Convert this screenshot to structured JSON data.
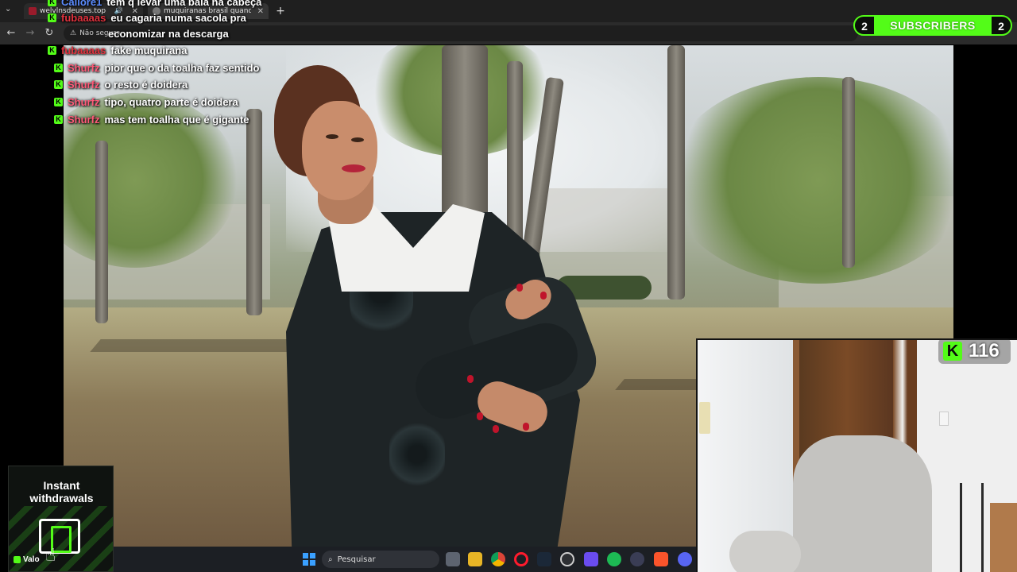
{
  "browser": {
    "tabs": [
      {
        "label": "welvlnsdeuses.top"
      },
      {
        "label": "muquiranas brasil quando foi gr"
      }
    ],
    "new_tab": "+",
    "security": "Não segura"
  },
  "chat": {
    "messages": [
      {
        "user": "Callore1",
        "user_color": "#5b8cff",
        "text": "tem q levar uma bala na cabeça"
      },
      {
        "user": "fubaaaas",
        "user_color": "#e2323e",
        "text": "eu cagaria numa sacola pra"
      },
      {
        "user": "",
        "user_color": "#e2323e",
        "text": "economizar na descarga"
      },
      {
        "user": "fubaaaas",
        "user_color": "#e2323e",
        "text": "fake muquirana"
      },
      {
        "user": "Shurfz",
        "user_color": "#ff5a78",
        "text": "pior que o da toalha faz sentido"
      },
      {
        "user": "Shurfz",
        "user_color": "#ff5a78",
        "text": "o resto é doidera"
      },
      {
        "user": "Shurfz",
        "user_color": "#ff5a78",
        "text": "tipo, quatro parte é doidera"
      },
      {
        "user": "Shurfz",
        "user_color": "#ff5a78",
        "text": "mas tem toalha que é gigante"
      }
    ]
  },
  "subscribers": {
    "label": "SUBSCRIBERS",
    "left_count": "2",
    "right_count": "2"
  },
  "viewers": {
    "count": "116",
    "icon": "kick-logo"
  },
  "promo": {
    "line1": "Instant",
    "line2": "withdrawals",
    "brand": "Valo"
  },
  "taskbar": {
    "search_placeholder": "Pesquisar"
  },
  "colors": {
    "accent": "#53fc18"
  }
}
